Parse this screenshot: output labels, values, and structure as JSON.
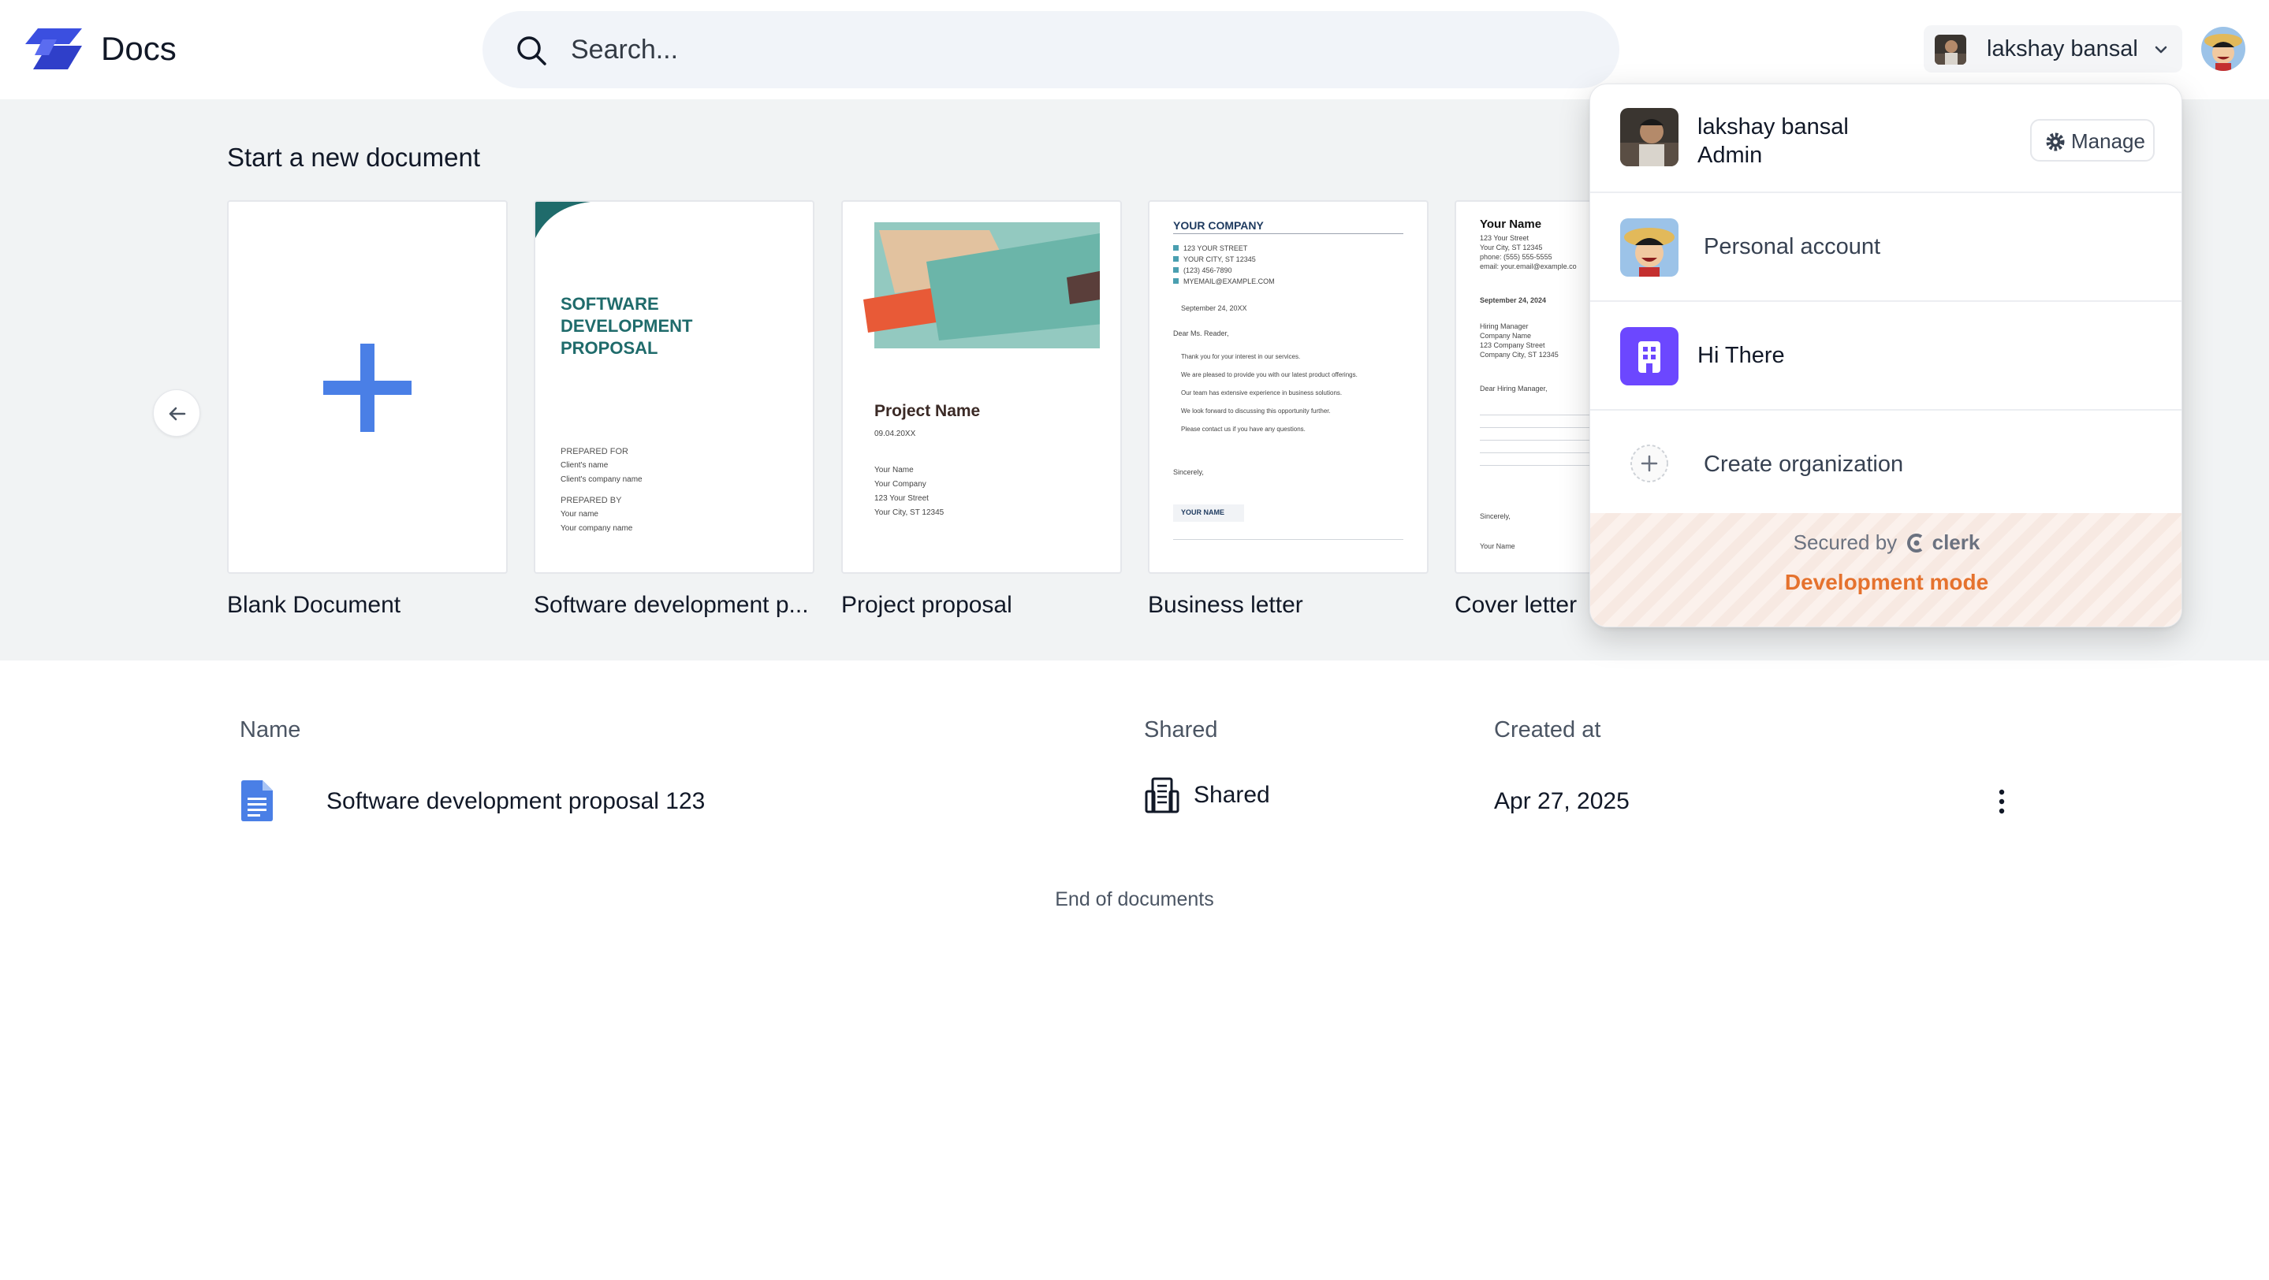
{
  "header": {
    "app_title": "Docs",
    "search_placeholder": "Search...",
    "org_switcher_name": "lakshay bansal"
  },
  "templates": {
    "title": "Start a new document",
    "cards": [
      {
        "label": "Blank Document"
      },
      {
        "label": "Software development p...",
        "title_lines": [
          "SOFTWARE",
          "DEVELOPMENT",
          "PROPOSAL"
        ],
        "prepared_for": "PREPARED FOR",
        "clients_name": "Client's name",
        "clients_company": "Client's company name",
        "prepared_by": "PREPARED BY",
        "your_name": "Your name",
        "your_company": "Your company name"
      },
      {
        "label": "Project proposal",
        "project_name": "Project Name",
        "date": "09.04.20XX",
        "lines": [
          "Your Name",
          "Your Company",
          "123 Your Street",
          "Your City, ST 12345"
        ]
      },
      {
        "label": "Business letter",
        "company": "YOUR COMPANY",
        "contact": [
          "123 YOUR STREET",
          "YOUR CITY, ST 12345",
          "(123) 456-7890",
          "MYEMAIL@EXAMPLE.COM"
        ],
        "date": "September 24, 20XX",
        "greeting": "Dear Ms. Reader,",
        "body": [
          "Thank you for your interest in our services.",
          "We are pleased to provide you with our latest product offerings.",
          "Our team has extensive experience in business solutions.",
          "We look forward to discussing this opportunity further.",
          "Please contact us if you have any questions."
        ],
        "closing": "Sincerely,",
        "signature": "YOUR NAME"
      },
      {
        "label": "Cover letter",
        "name": "Your Name",
        "contact": [
          "123 Your Street",
          "Your City, ST 12345",
          "phone: (555) 555-5555",
          "email: your.email@example.co"
        ],
        "date": "September 24, 2024",
        "recipient": [
          "Hiring Manager",
          "Company Name",
          "123 Company Street",
          "Company City, ST 12345"
        ],
        "greeting": "Dear Hiring Manager,",
        "closing": "Sincerely,",
        "signature": "Your Name"
      }
    ]
  },
  "table": {
    "headers": {
      "name": "Name",
      "shared": "Shared",
      "created": "Created at"
    },
    "rows": [
      {
        "name": "Software development proposal 123",
        "shared": "Shared",
        "created": "Apr 27, 2025"
      }
    ],
    "end_text": "End of documents"
  },
  "popover": {
    "user_name": "lakshay bansal",
    "user_role": "Admin",
    "manage_label": "Manage",
    "personal_account": "Personal account",
    "org_name": "Hi There",
    "create_org": "Create organization",
    "secured_by": "Secured by",
    "secured_brand": "clerk",
    "dev_mode": "Development mode"
  },
  "colors": {
    "accent_blue": "#4a7fe6",
    "logo_blue": "#3b4fe0",
    "template_teal": "#1f6b6b",
    "dev_mode_orange": "#e5722e",
    "org_purple": "#6c47ff"
  },
  "icons": [
    "search-icon",
    "chevron-down-icon",
    "arrow-left-icon",
    "plus-icon",
    "document-icon",
    "building-icon",
    "more-vertical-icon",
    "gear-icon",
    "org-building-icon",
    "plus-circle-icon",
    "clerk-logo-icon"
  ]
}
